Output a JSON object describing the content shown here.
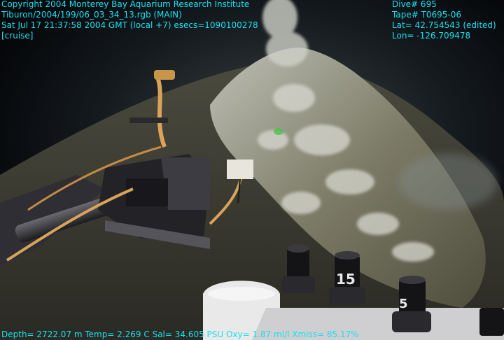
{
  "overlay": {
    "left_lines": [
      "Copyright 2004 Monterey Bay Aquarium Research Institute",
      "Tiburon/2004/199/06_03_34_13.rgb (MAIN)",
      "Sat Jul 17 21:37:58 2004 GMT (local +7)  esecs=1090100278",
      "[cruise]"
    ],
    "right_lines": [
      "Dive# 695",
      "Tape# T0695-06",
      "Lat= 42.754543 (edited)",
      "Lon= -126.709478"
    ],
    "bottom_line": "Depth= 2722.07 m  Temp= 2.269 C  Sal= 34.605 PSU  Oxy= 1.87 ml/l  Xmiss= 85.17%"
  },
  "scene": {
    "marker_labels": [
      "15",
      "5"
    ]
  },
  "colors": {
    "overlay_text": "#19e0f0",
    "water": "#06080b",
    "seafloor": "#5c5a4a",
    "sediment_white": "#d8d8d0",
    "rope": "#d9a35a"
  }
}
